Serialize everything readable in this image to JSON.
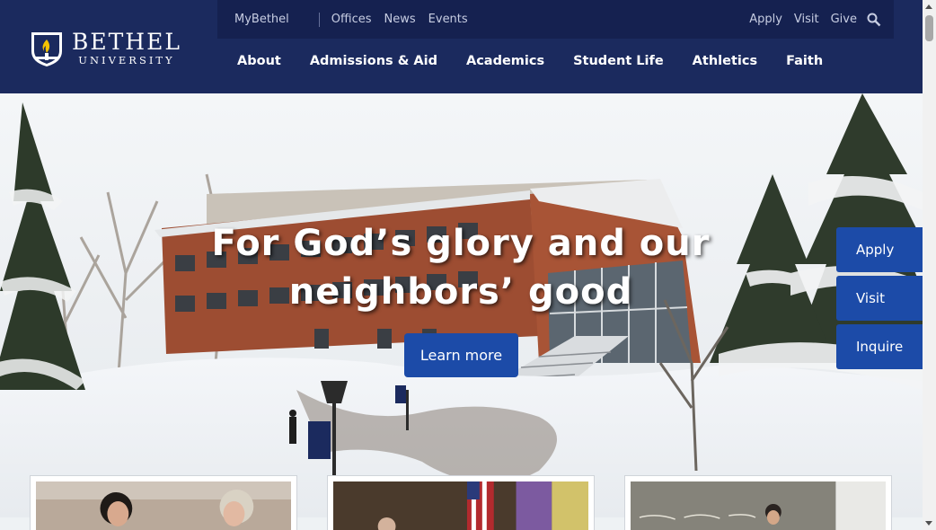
{
  "brand": {
    "name": "BETHEL",
    "subtitle": "UNIVERSITY",
    "color_primary": "#1b2a5e",
    "color_accent": "#1c4ba8"
  },
  "utility_nav": {
    "left": [
      "MyBethel",
      "Offices",
      "News",
      "Events"
    ],
    "right": [
      "Apply",
      "Visit",
      "Give"
    ],
    "search_icon": "search-icon"
  },
  "main_nav": [
    "About",
    "Admissions & Aid",
    "Academics",
    "Student Life",
    "Athletics",
    "Faith"
  ],
  "hero": {
    "title_line1": "For God’s glory and our",
    "title_line2": "neighbors’ good",
    "button": "Learn more"
  },
  "side_cta": [
    "Apply",
    "Visit",
    "Inquire"
  ],
  "cards": [
    "feature-card-1",
    "feature-card-2",
    "feature-card-3"
  ]
}
